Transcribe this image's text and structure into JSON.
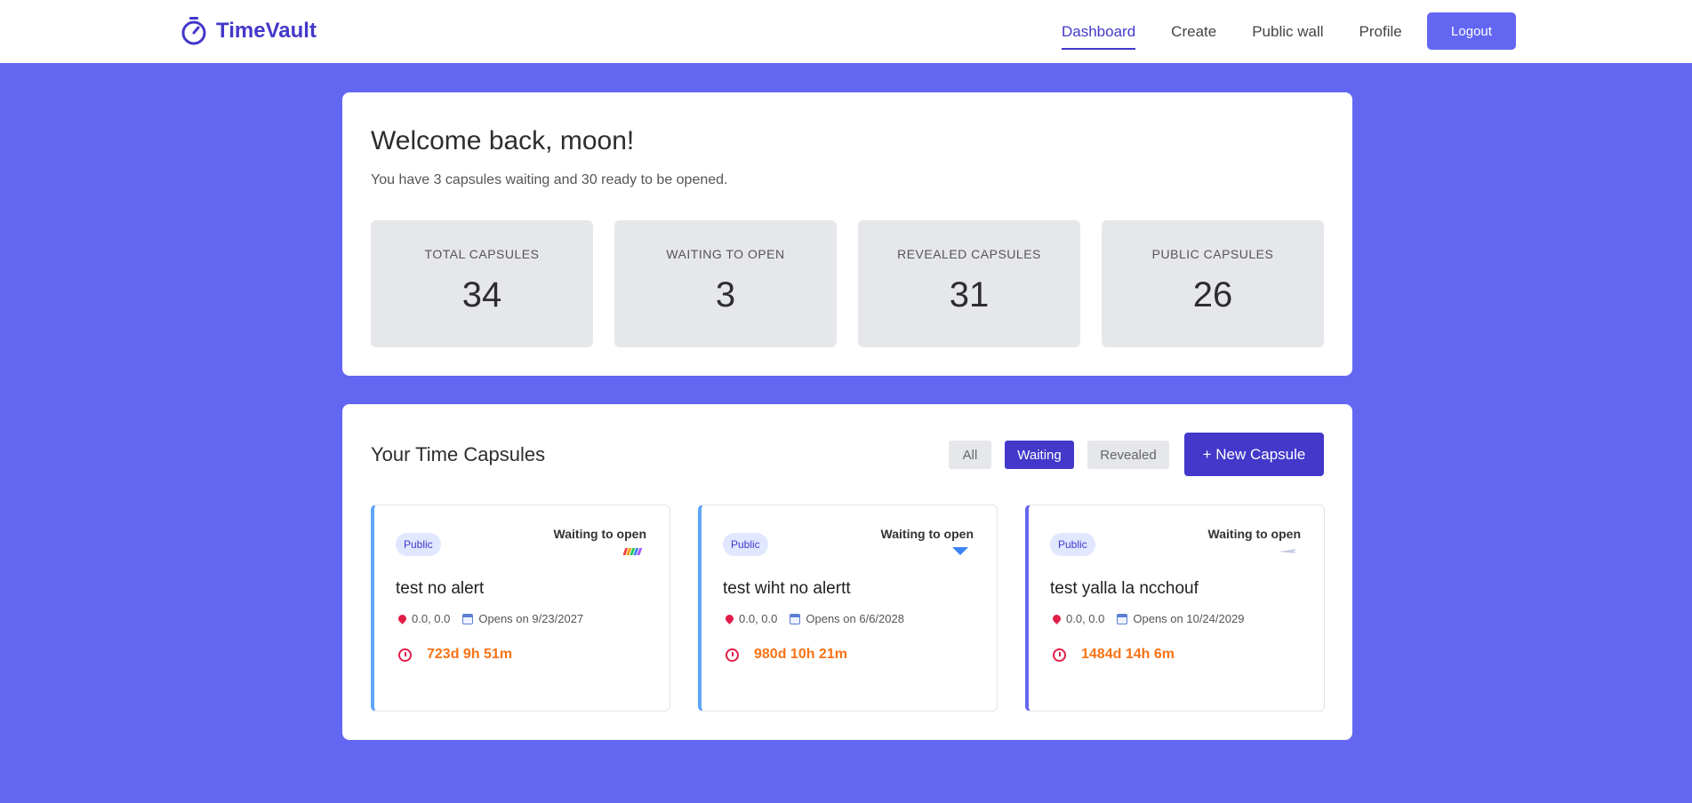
{
  "nav": {
    "brand": "TimeVault",
    "links": [
      "Dashboard",
      "Create",
      "Public wall",
      "Profile"
    ],
    "active": "Dashboard",
    "logout": "Logout"
  },
  "welcome": {
    "title": "Welcome back, moon!",
    "subtitle": "You have 3 capsules waiting and 30 ready to be opened."
  },
  "stats": [
    {
      "label": "TOTAL CAPSULES",
      "value": "34"
    },
    {
      "label": "WAITING TO OPEN",
      "value": "3"
    },
    {
      "label": "REVEALED CAPSULES",
      "value": "31"
    },
    {
      "label": "PUBLIC CAPSULES",
      "value": "26"
    }
  ],
  "capsules_section": {
    "title": "Your Time Capsules",
    "filters": [
      "All",
      "Waiting",
      "Revealed"
    ],
    "active_filter": "Waiting",
    "new_button": "+ New Capsule"
  },
  "capsules": [
    {
      "badge": "Public",
      "status": "Waiting to open",
      "title": "test no alert",
      "location": "0.0, 0.0",
      "opens": "Opens on 9/23/2027",
      "countdown": "723d 9h 51m",
      "decoration": "rainbow-icon"
    },
    {
      "badge": "Public",
      "status": "Waiting to open",
      "title": "test wiht no alertt",
      "location": "0.0, 0.0",
      "opens": "Opens on 6/6/2028",
      "countdown": "980d 10h 21m",
      "decoration": "blue-triangle-icon"
    },
    {
      "badge": "Public",
      "status": "Waiting to open",
      "title": "test yalla la ncchouf",
      "location": "0.0, 0.0",
      "opens": "Opens on 10/24/2029",
      "countdown": "1484d 14h 6m",
      "decoration": "airplane-icon"
    }
  ],
  "colors": {
    "background": "#6366f1",
    "accent": "#4338ca",
    "countdown": "#f97316"
  }
}
